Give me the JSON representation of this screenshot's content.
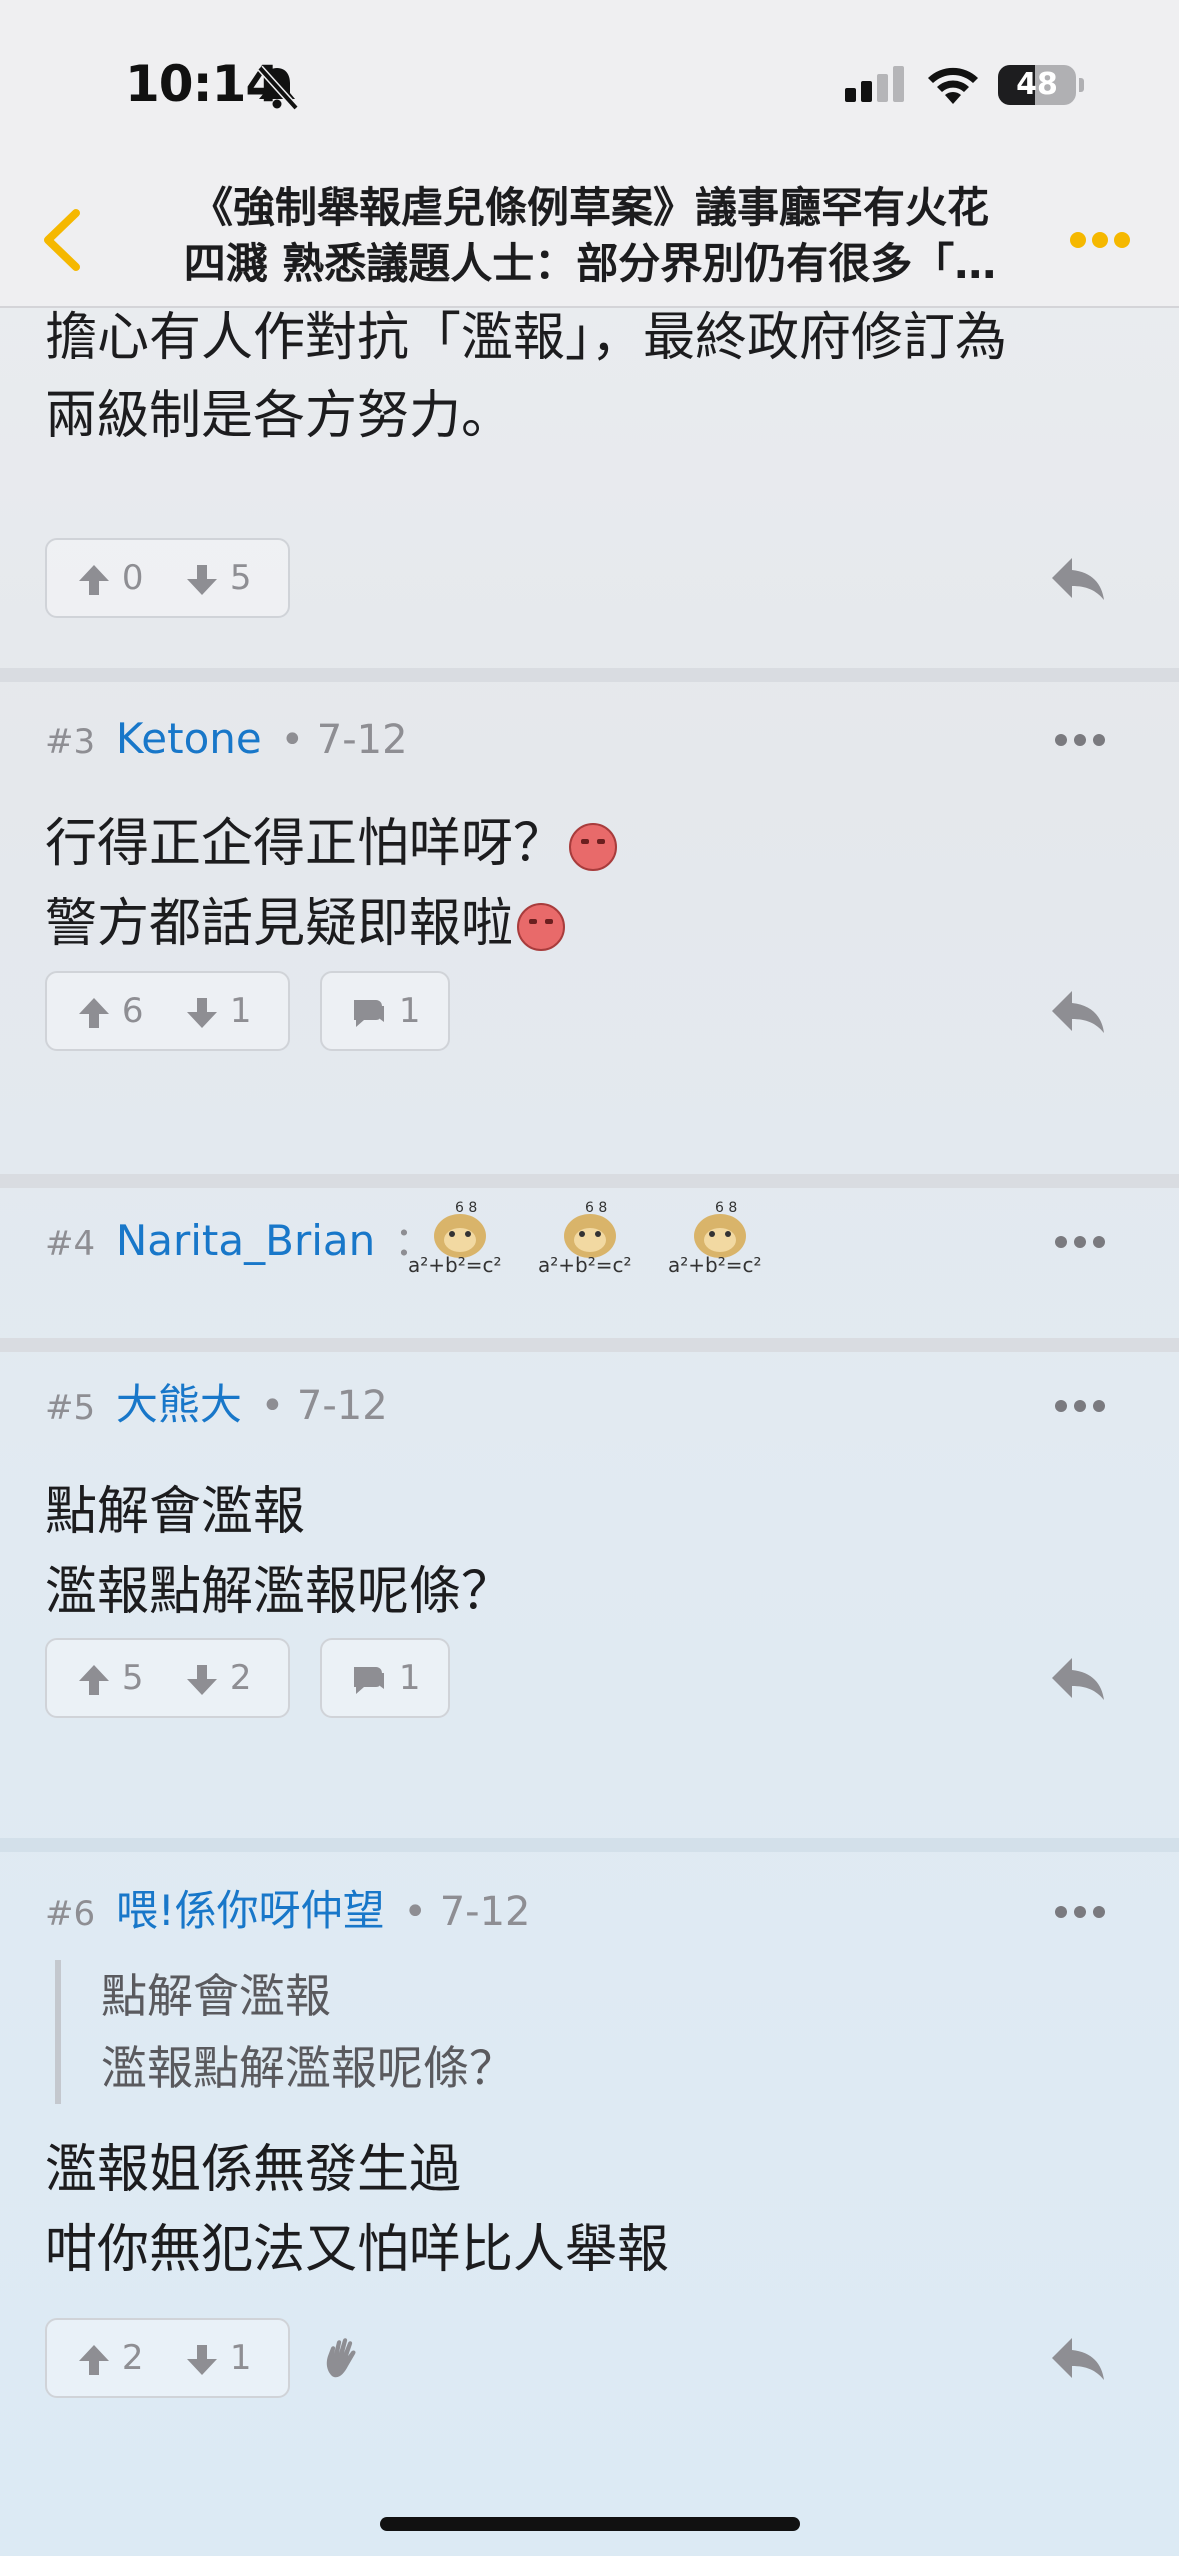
{
  "status": {
    "time": "10:14",
    "battery": "48",
    "battery_level": 0.48
  },
  "nav": {
    "title_line1": "《強制舉報虐兒條例草案》議事廳罕有火花",
    "title_line2": "四濺 熟悉議題人士：部分界別仍有很多「…"
  },
  "posts": [
    {
      "partial_top_line": "擔心有人作對抗「濫報」，最終政府修訂為",
      "partial_line2": "兩級制是各方努力。",
      "up": "0",
      "down": "5"
    },
    {
      "num": "#3",
      "user": "Ketone",
      "date": "• 7-12",
      "line1": "行得正企得正怕咩呀？",
      "line2": "警方都話見疑即報啦",
      "up": "6",
      "down": "1",
      "comments": "1"
    },
    {
      "num": "#4",
      "user": "Narita_Brian",
      "colon": "："
    },
    {
      "num": "#5",
      "user": "大熊大",
      "date": "• 7-12",
      "line1": "點解會濫報",
      "line2": "濫報點解濫報呢條？",
      "up": "5",
      "down": "2",
      "comments": "1"
    },
    {
      "num": "#6",
      "user": "喂!係你呀仲望",
      "date": "• 7-12",
      "quote_line1": "點解會濫報",
      "quote_line2": "濫報點解濫報呢條？",
      "line1": "濫報姐係無發生過",
      "line2": "咁你無犯法又怕咩比人舉報",
      "up": "2",
      "down": "1"
    }
  ],
  "colors": {
    "accent": "#f5b800",
    "username": "#1877c9"
  }
}
